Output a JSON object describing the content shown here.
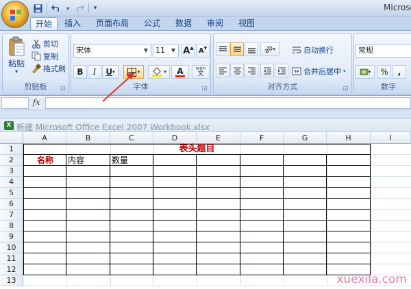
{
  "titlebar": {
    "title": "Microso"
  },
  "qat": {
    "more": "▾"
  },
  "tabs": [
    "开始",
    "插入",
    "页面布局",
    "公式",
    "数据",
    "审阅",
    "视图"
  ],
  "clipboard": {
    "paste": "粘贴",
    "cut": "剪切",
    "copy": "复制",
    "format_painter": "格式刷",
    "label": "剪贴板"
  },
  "font": {
    "name": "宋体",
    "size": "11",
    "grow": "A",
    "shrink": "A",
    "bold": "B",
    "italic": "I",
    "underline": "U",
    "color_letter": "A",
    "phonetic": "wén",
    "label": "字体",
    "fill_color": "#f6e200",
    "font_color": "#d62a1e"
  },
  "alignment": {
    "wrap_text": "自动换行",
    "merge_center": "合并后居中",
    "label": "对齐方式"
  },
  "number": {
    "format": "常规",
    "percent": "%",
    "comma": ",",
    "label": "数字"
  },
  "formula_bar": {
    "fx": "fx",
    "value": ""
  },
  "workbook": {
    "title": "新建 Microsoft Office Excel 2007 Workbook.xlsx"
  },
  "sheet": {
    "columns": [
      "A",
      "B",
      "C",
      "D",
      "E",
      "F",
      "G",
      "H",
      "I"
    ],
    "rows": [
      "1",
      "2",
      "3",
      "4",
      "5",
      "6",
      "7",
      "8",
      "9",
      "10",
      "11",
      "12",
      "13"
    ],
    "header_title": "表头题目",
    "header_title_color": "#c00000",
    "cells": {
      "A2": "名称",
      "B2": "内容",
      "C2": "数量"
    },
    "a2_color": "#c00000"
  },
  "watermark": "xuexila.com",
  "accent": "#e0312a"
}
